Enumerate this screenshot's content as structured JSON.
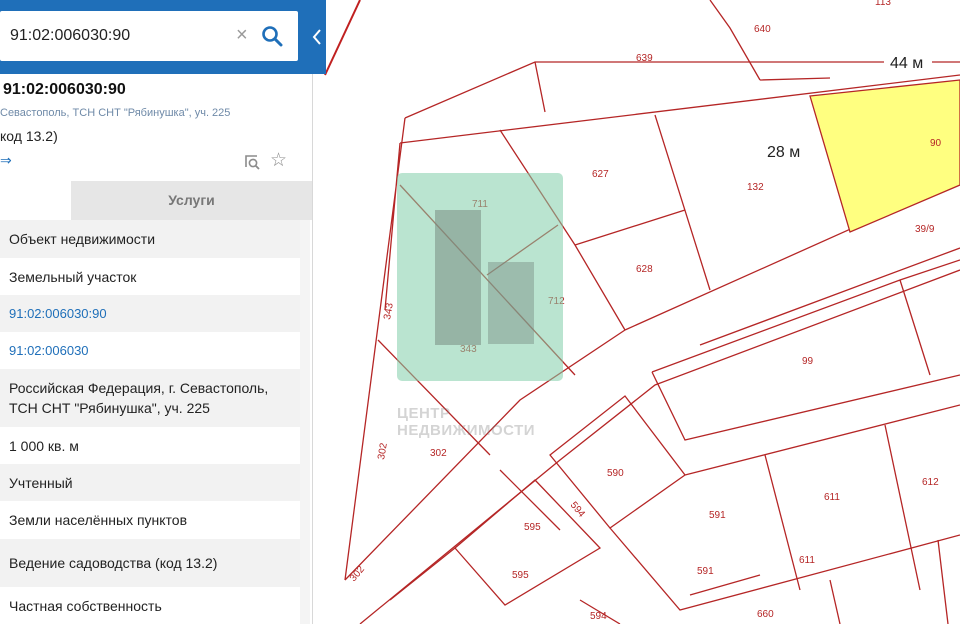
{
  "search": {
    "value": "91:02:006030:90",
    "clear_symbol": "×"
  },
  "object": {
    "title": "91:02:006030:90",
    "address_short": "Севастополь, ТСН СНТ \"Рябинушка\", уч. 225",
    "usage_short": "код 13.2)",
    "link_symbol": "⇒",
    "favorite_symbol": "☆"
  },
  "tabs": {
    "services": "Услуги"
  },
  "rows": [
    {
      "text": "Объект недвижимости",
      "type": "text"
    },
    {
      "text": "Земельный участок",
      "type": "text"
    },
    {
      "text": "91:02:006030:90",
      "type": "link"
    },
    {
      "text": "91:02:006030",
      "type": "link"
    },
    {
      "text": "Российская Федерация, г. Севастополь, ТСН СНТ \"Рябинушка\", уч. 225",
      "type": "text"
    },
    {
      "text": "1 000 кв. м",
      "type": "text"
    },
    {
      "text": "Учтенный",
      "type": "text"
    },
    {
      "text": "Земли населённых пунктов",
      "type": "text"
    },
    {
      "text": "Ведение садоводства (код 13.2)",
      "type": "text"
    },
    {
      "text": "Частная собственность",
      "type": "text"
    }
  ],
  "map": {
    "dimension_top": "44 м",
    "dimension_side": "28 м",
    "parcel_labels": [
      "113",
      "640",
      "639",
      "90",
      "627",
      "132",
      "711",
      "39/9",
      "628",
      "712",
      "343",
      "343",
      "99",
      "302",
      "302",
      "590",
      "611",
      "612",
      "594",
      "595",
      "591",
      "595",
      "591",
      "611",
      "594",
      "660",
      "302"
    ],
    "watermark_caption": [
      "ЦЕНТР",
      "НЕДВИЖИМОСТИ"
    ],
    "selected_color": "#ffff80",
    "boundary_color": "#b52626"
  },
  "colors": {
    "accent": "#1f6fb9",
    "tab_inactive": "#e6e6e6",
    "row_shade": "#f2f2f2"
  }
}
